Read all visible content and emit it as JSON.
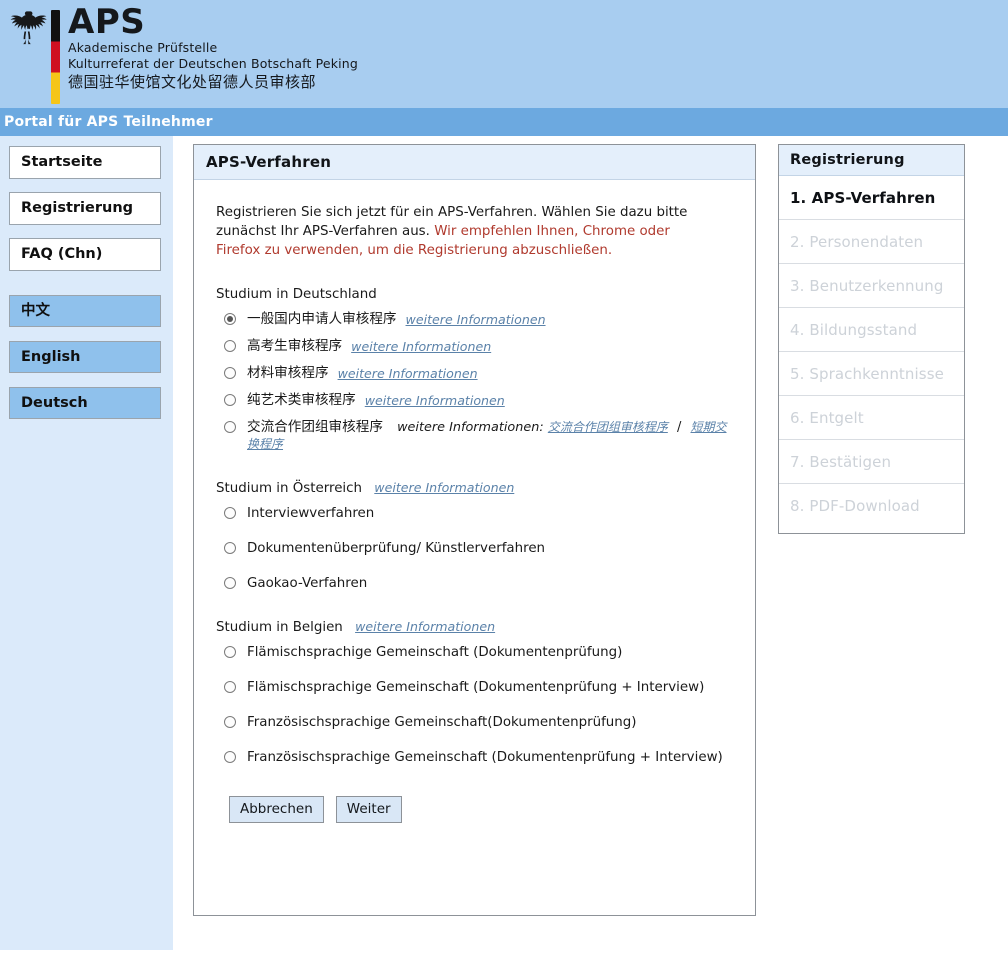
{
  "header": {
    "emblem_icon": "german-federal-eagle-icon",
    "flag_icon": "german-flag-bar-icon",
    "title": "APS",
    "subtitle_line1": "Akademische Prüfstelle",
    "subtitle_line2": "Kulturreferat der Deutschen Botschaft Peking",
    "subtitle_cn": "德国驻华使馆文化处留德人员审核部",
    "portal_bar": "Portal für APS Teilnehmer"
  },
  "sidebar": {
    "nav": [
      {
        "label": "Startseite"
      },
      {
        "label": "Registrierung"
      },
      {
        "label": "FAQ (Chn)"
      }
    ],
    "languages": [
      {
        "label": "中文"
      },
      {
        "label": "English"
      },
      {
        "label": "Deutsch"
      }
    ]
  },
  "main": {
    "panel_title": "APS-Verfahren",
    "intro_line1": "Registrieren Sie sich jetzt für ein APS-Verfahren. Wählen Sie dazu bitte",
    "intro_line2": "zunächst Ihr APS-Verfahren aus.",
    "warning": "Wir empfehlen Ihnen, Chrome oder Firefox zu verwenden, um die Registrierung abzuschließen.",
    "info_link_label": "weitere Informationen",
    "info_prefix_label": "weitere Informationen:",
    "separator": "/",
    "germany": {
      "title": "Studium in Deutschland",
      "options": [
        {
          "label": "一般国内申请人审核程序",
          "link": "weitere Informationen",
          "selected": true
        },
        {
          "label": "高考生审核程序",
          "link": "weitere Informationen",
          "selected": false
        },
        {
          "label": "材料审核程序",
          "link": "weitere Informationen",
          "selected": false
        },
        {
          "label": "纯艺术类审核程序",
          "link": "weitere Informationen",
          "selected": false
        },
        {
          "label": "交流合作团组审核程序",
          "selected": false,
          "info_prefix": "weitere Informationen:",
          "link_cn_1": "交流合作团组审核程序",
          "link_cn_2": "短期交换程序"
        }
      ]
    },
    "austria": {
      "title": "Studium in Österreich",
      "link": "weitere Informationen",
      "options": [
        {
          "label": "Interviewverfahren",
          "selected": false
        },
        {
          "label": "Dokumentenüberprüfung/ Künstlerverfahren",
          "selected": false
        },
        {
          "label": "Gaokao-Verfahren",
          "selected": false
        }
      ]
    },
    "belgium": {
      "title": "Studium in Belgien",
      "link": "weitere Informationen",
      "options": [
        {
          "label": "Flämischsprachige Gemeinschaft (Dokumentenprüfung)",
          "selected": false
        },
        {
          "label": "Flämischsprachige Gemeinschaft (Dokumentenprüfung + Interview)",
          "selected": false
        },
        {
          "label": "Französischsprachige Gemeinschaft(Dokumentenprüfung)",
          "selected": false
        },
        {
          "label": "Französischsprachige Gemeinschaft (Dokumentenprüfung + Interview)",
          "selected": false
        }
      ]
    },
    "buttons": {
      "cancel": "Abbrechen",
      "next": "Weiter"
    }
  },
  "steps": {
    "panel_title": "Registrierung",
    "items": [
      {
        "label": "1. APS-Verfahren",
        "active": true
      },
      {
        "label": "2. Personendaten",
        "active": false
      },
      {
        "label": "3. Benutzerkennung",
        "active": false
      },
      {
        "label": "4. Bildungsstand",
        "active": false
      },
      {
        "label": "5. Sprachkenntnisse",
        "active": false
      },
      {
        "label": "6. Entgelt",
        "active": false
      },
      {
        "label": "7. Bestätigen",
        "active": false
      },
      {
        "label": "8. PDF-Download",
        "active": false
      }
    ]
  }
}
